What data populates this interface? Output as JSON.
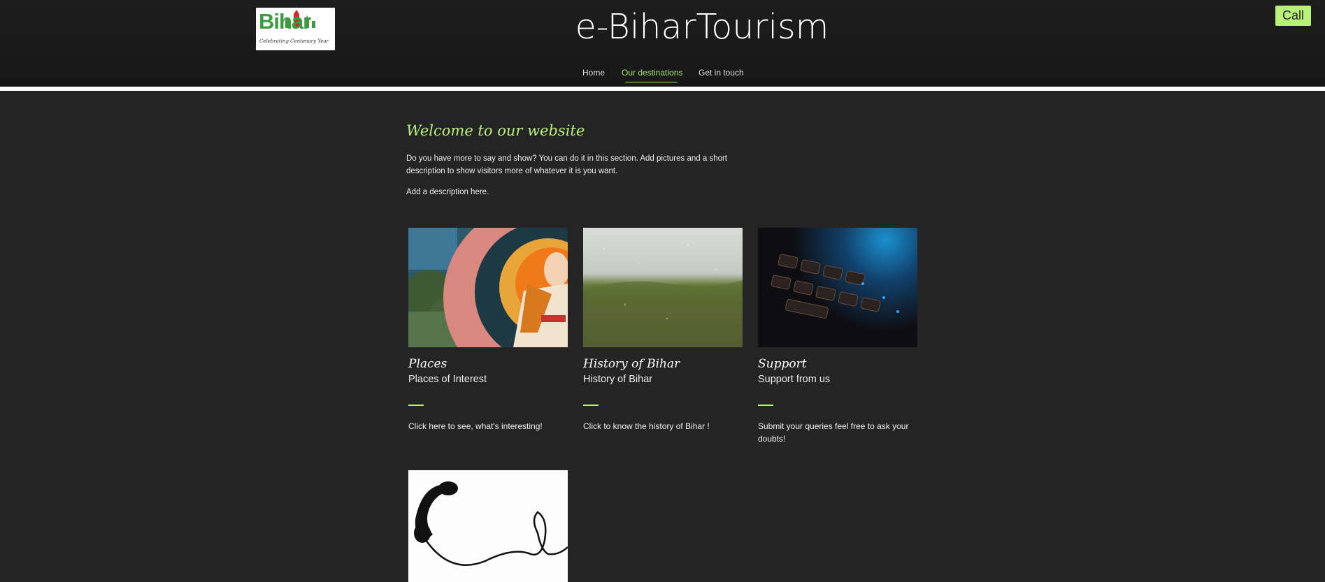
{
  "header": {
    "logo": {
      "word": "Bihar",
      "tagline": "Celebrating Centenary Year"
    },
    "site_title": "e-BiharTourism",
    "call_label": "Call"
  },
  "nav": {
    "items": [
      {
        "label": "Home",
        "active": false
      },
      {
        "label": "Our destinations",
        "active": true
      },
      {
        "label": "Get in touch",
        "active": false
      }
    ]
  },
  "intro": {
    "heading": "Welcome to our website",
    "paragraph": "Do you have more to say and show? You can do it in this section. Add pictures and a short description to show visitors more of whatever it is you want.",
    "sub": "Add a description here."
  },
  "cards": [
    {
      "script": "Places",
      "title": "Places of Interest",
      "desc": "Click here to see, what's interesting!"
    },
    {
      "script": "History of Bihar",
      "title": "History of Bihar",
      "desc": "Click to know the history of Bihar !"
    },
    {
      "script": "Support",
      "title": "Support from us",
      "desc": "Submit your queries feel free to ask your doubts!"
    }
  ],
  "colors": {
    "accent": "#b8f07a",
    "background": "#242424",
    "header": "#1a1a1a"
  }
}
